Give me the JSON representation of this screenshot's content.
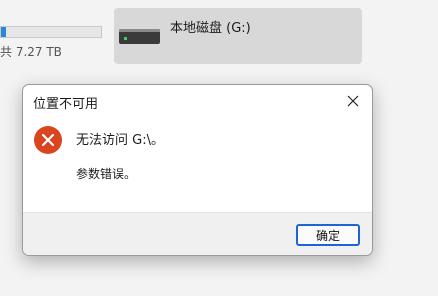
{
  "background": {
    "capacity_text": "共 7.27 TB",
    "drive_label": "本地磁盘 (G:)",
    "drive_icon": "hard-drive-icon"
  },
  "dialog": {
    "title": "位置不可用",
    "message": "无法访问 G:\\。",
    "detail": "参数错误。",
    "ok_label": "确定",
    "close_icon": "close-icon",
    "error_icon": "error-icon",
    "colors": {
      "error": "#d9451e",
      "accent": "#1f63d6"
    }
  }
}
